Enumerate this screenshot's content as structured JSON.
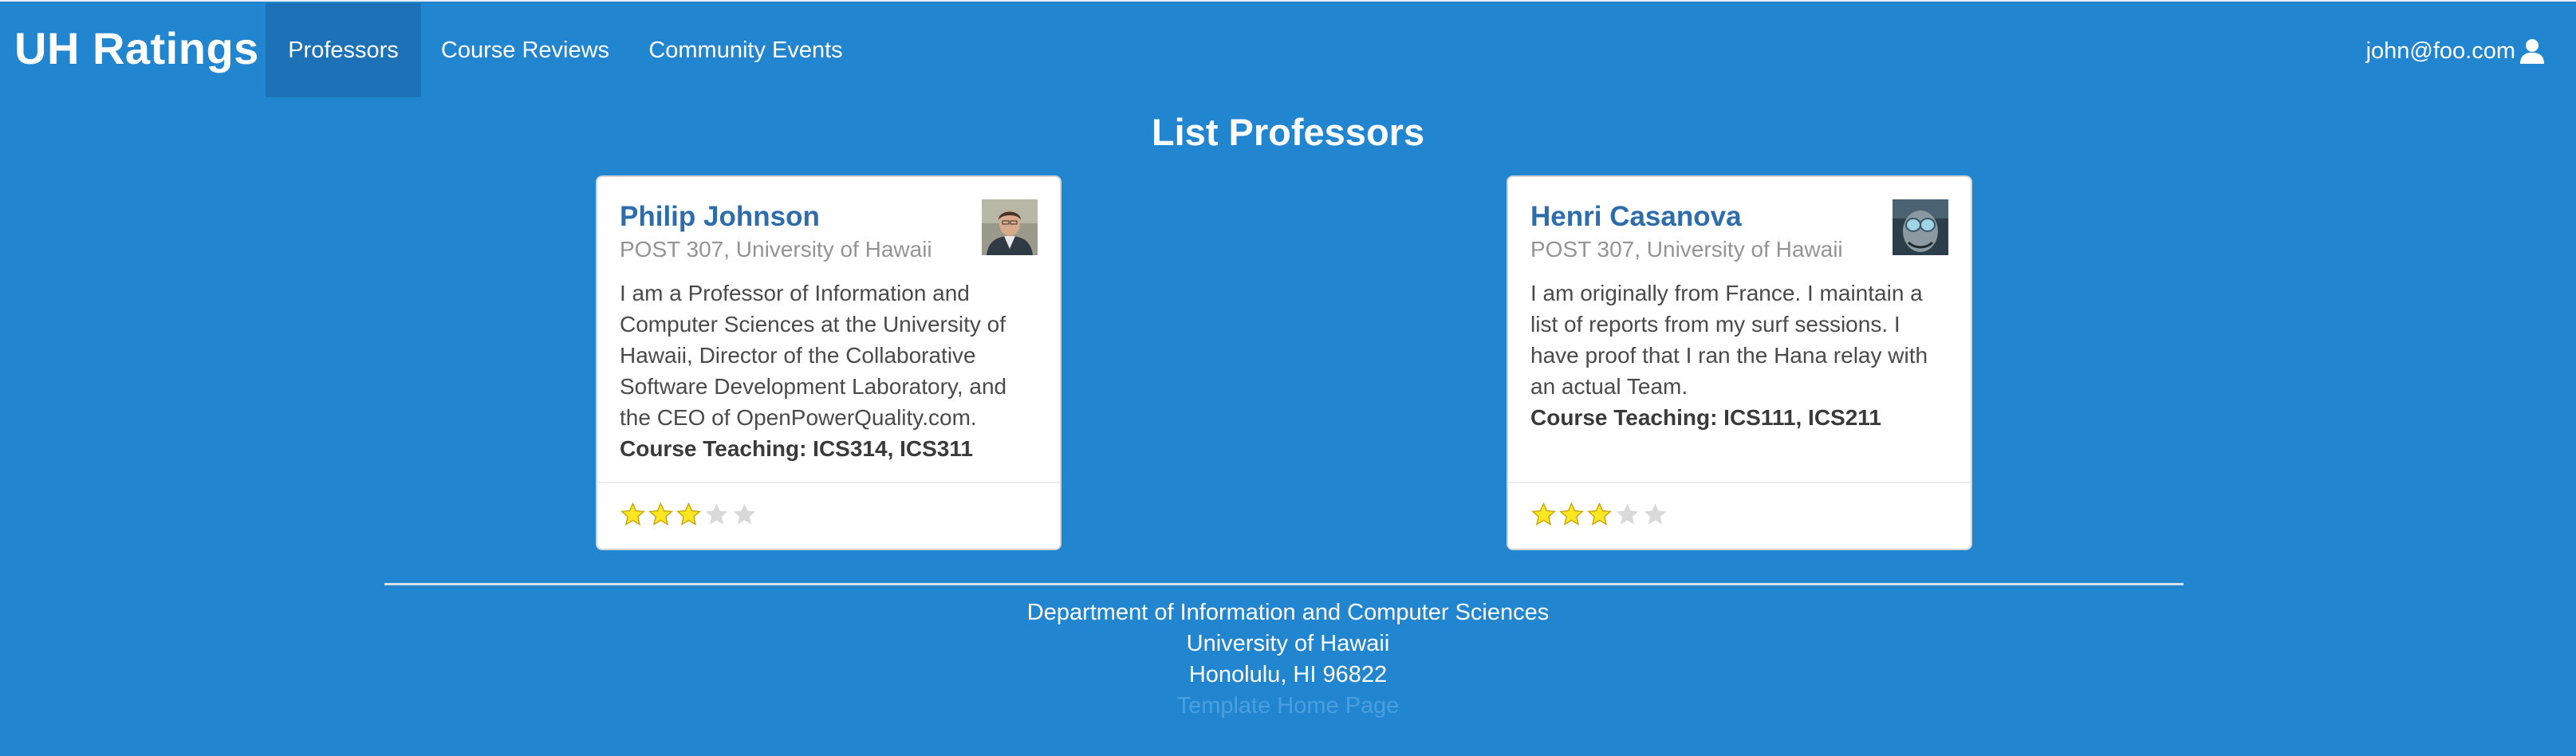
{
  "navbar": {
    "brand": "UH Ratings",
    "items": [
      {
        "label": "Professors",
        "active": true
      },
      {
        "label": "Course Reviews",
        "active": false
      },
      {
        "label": "Community Events",
        "active": false
      }
    ],
    "user_email": "john@foo.com",
    "user_icon": "user-icon"
  },
  "page": {
    "title": "List Professors"
  },
  "professors": [
    {
      "name": "Philip Johnson",
      "office": "POST 307, University of Hawaii",
      "description": "I am a Professor of Information and Computer Sciences at the University of Hawaii, Director of the Collaborative Software Development Laboratory, and the CEO of OpenPowerQuality.com.",
      "course_teaching": "Course Teaching: ICS314, ICS311",
      "rating": 3,
      "rating_max": 5
    },
    {
      "name": "Henri Casanova",
      "office": "POST 307, University of Hawaii",
      "description": "I am originally from France. I maintain a list of reports from my surf sessions. I have proof that I ran the Hana relay with an actual Team.",
      "course_teaching": "Course Teaching: ICS111, ICS211",
      "rating": 3,
      "rating_max": 5
    }
  ],
  "footer": {
    "line1": "Department of Information and Computer Sciences",
    "line2": "University of Hawaii",
    "line3": "Honolulu, HI 96822",
    "link": "Template Home Page"
  },
  "colors": {
    "background": "#2185D0",
    "active_nav": "#1d72b7",
    "card_header": "#2d6dab",
    "star_filled": "#FFE623",
    "star_empty": "#d9d9d9"
  }
}
